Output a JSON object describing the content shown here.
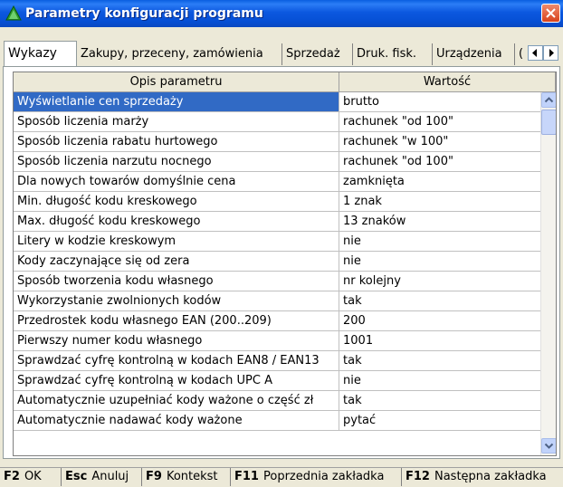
{
  "window": {
    "title": "Parametry konfiguracji programu"
  },
  "tabs": [
    {
      "label": "Wykazy",
      "active": true
    },
    {
      "label": "Zakupy, przeceny, zamówienia"
    },
    {
      "label": "Sprzedaż"
    },
    {
      "label": "Druk. fisk."
    },
    {
      "label": "Urządzenia"
    },
    {
      "label": "("
    }
  ],
  "grid": {
    "columns": [
      "Opis parametru",
      "Wartość"
    ],
    "rows": [
      {
        "name": "Wyświetlanie cen sprzedaży",
        "value": "brutto"
      },
      {
        "name": "Sposób liczenia marży",
        "value": "rachunek \"od 100\""
      },
      {
        "name": "Sposób liczenia rabatu hurtowego",
        "value": "rachunek \"w 100\""
      },
      {
        "name": "Sposób liczenia narzutu nocnego",
        "value": "rachunek \"od 100\""
      },
      {
        "name": "Dla nowych towarów domyślnie cena",
        "value": "zamknięta"
      },
      {
        "name": "Min. długość kodu kreskowego",
        "value": "1 znak"
      },
      {
        "name": "Max. długość kodu kreskowego",
        "value": "13 znaków"
      },
      {
        "name": "Litery w kodzie kreskowym",
        "value": "nie"
      },
      {
        "name": "Kody zaczynające się od zera",
        "value": "nie"
      },
      {
        "name": "Sposób tworzenia kodu własnego",
        "value": "nr kolejny"
      },
      {
        "name": "Wykorzystanie zwolnionych kodów",
        "value": "tak"
      },
      {
        "name": "Przedrostek kodu własnego EAN (200..209)",
        "value": "200"
      },
      {
        "name": "Pierwszy numer kodu własnego",
        "value": "1001"
      },
      {
        "name": "Sprawdzać cyfrę kontrolną w kodach EAN8 / EAN13",
        "value": "tak"
      },
      {
        "name": "Sprawdzać cyfrę kontrolną w kodach UPC A",
        "value": "nie"
      },
      {
        "name": "Automatycznie uzupełniać kody ważone o część zł",
        "value": "tak"
      },
      {
        "name": "Automatycznie nadawać kody ważone",
        "value": "pytać"
      }
    ]
  },
  "statusbar": [
    {
      "key": "F2",
      "label": "OK"
    },
    {
      "key": "Esc",
      "label": "Anuluj"
    },
    {
      "key": "F9",
      "label": "Kontekst"
    },
    {
      "key": "F11",
      "label": "Poprzednia zakładka"
    },
    {
      "key": "F12",
      "label": "Następna zakładka"
    }
  ],
  "icons": {
    "app": "green-tree-icon",
    "close": "close-icon",
    "tab_left": "scroll-left-arrow-icon",
    "tab_right": "scroll-right-arrow-icon",
    "scroll_up": "scroll-up-arrow-icon",
    "scroll_down": "scroll-down-arrow-icon"
  },
  "colors": {
    "titlebar": "#0a5fe0",
    "selection": "#316ac5",
    "close": "#d8431c"
  }
}
